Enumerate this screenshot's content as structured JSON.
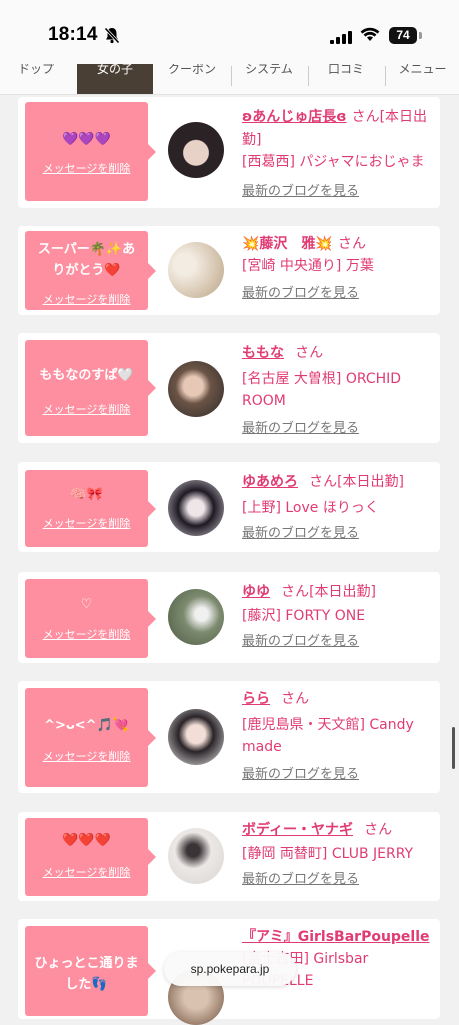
{
  "status": {
    "time": "18:14",
    "battery": "74"
  },
  "tabs": [
    "ドップ",
    "女の子",
    "クーポン",
    "システム",
    "口コミ",
    "メニュー"
  ],
  "browser": {
    "url": "sp.pokepara.jp"
  },
  "cards": [
    {
      "message": "💜💜💜",
      "delete_label": "メッセージを削除",
      "name": "ʚあんじゅ店長ɞ",
      "honorific": "さん",
      "status": "[本日出勤]",
      "shop": "[西葛西] パジャマにおじゃま",
      "blog_link": "最新のブログを見る"
    },
    {
      "message": "スーパー🌴✨ありがとう❤️",
      "delete_label": "メッセージを削除",
      "name": "💥藤沢　雅💥",
      "honorific": "さん",
      "status": "",
      "shop": "[宮崎 中央通り] 万葉",
      "blog_link": "最新のブログを見る"
    },
    {
      "message": "ももなのすぱ🤍",
      "delete_label": "メッセージを削除",
      "name": "ももな",
      "honorific": "さん",
      "status": "",
      "shop": "[名古屋 大曽根] ORCHID ROOM",
      "blog_link": "最新のブログを見る"
    },
    {
      "message": "🧠🎀",
      "delete_label": "メッセージを削除",
      "name": "ゆあめろ",
      "honorific": "さん",
      "status": "[本日出勤]",
      "shop": "[上野] Love ほりっく",
      "blog_link": "最新のブログを見る"
    },
    {
      "message": "♡",
      "delete_label": "メッセージを削除",
      "name": "ゆゆ",
      "honorific": "さん",
      "status": "[本日出勤]",
      "shop": "[藤沢] FORTY ONE",
      "blog_link": "最新のブログを見る"
    },
    {
      "message": "^>ᴗ<^🎵💘",
      "delete_label": "メッセージを削除",
      "name": "らら",
      "honorific": "さん",
      "status": "",
      "shop": "[鹿児島県・天文館] Candy made",
      "blog_link": "最新のブログを見る"
    },
    {
      "message": "❤️❤️❤️",
      "delete_label": "メッセージを削除",
      "name": "ボディー・ヤナギ",
      "honorific": "さん",
      "status": "",
      "shop": "[静岡 両替町] CLUB JERRY",
      "blog_link": "最新のブログを見る"
    },
    {
      "message": "ひょっとこ通りました👣",
      "delete_label": "",
      "name": "『アミ』GirlsBarPoupelle",
      "honorific": "",
      "status": "",
      "shop": "[富士吉田] Girlsbar POUPELLE",
      "blog_link": ""
    }
  ]
}
